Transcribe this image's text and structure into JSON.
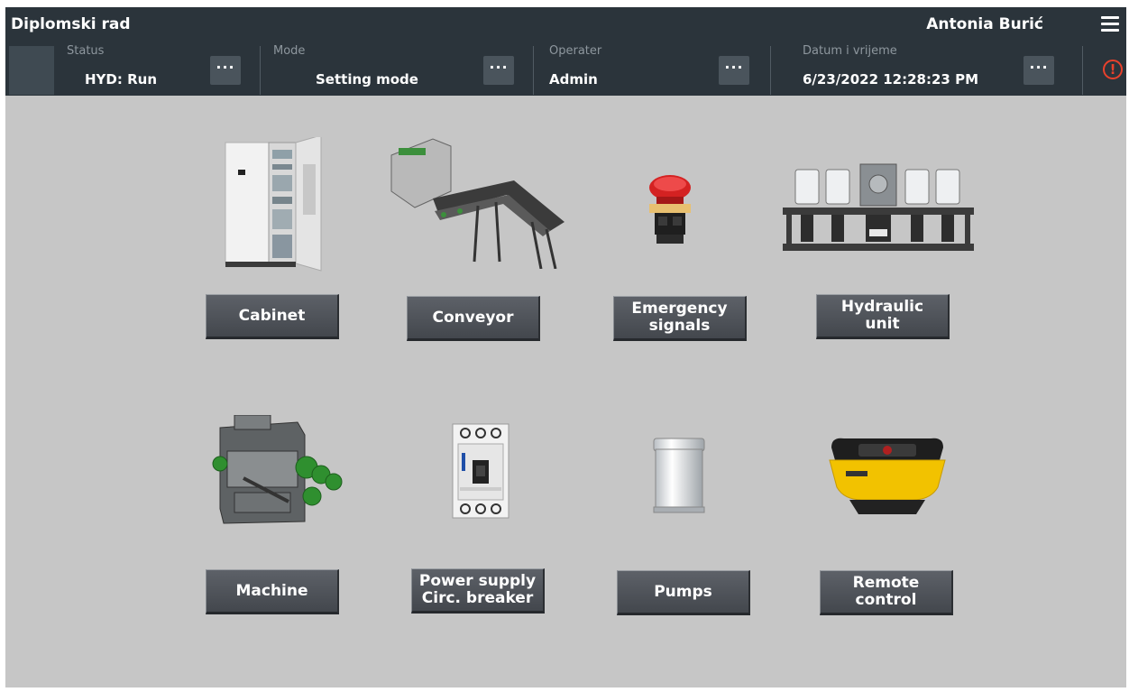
{
  "header": {
    "app_title": "Diplomski rad",
    "user_name": "Antonia Burić"
  },
  "status_bar": {
    "status": {
      "caption": "Status",
      "value": "HYD: Run"
    },
    "mode": {
      "caption": "Mode",
      "value": "Setting mode"
    },
    "operator": {
      "caption": "Operater",
      "value": "Admin"
    },
    "datetime": {
      "caption": "Datum i vrijeme",
      "value": "6/23/2022 12:28:23 PM"
    },
    "more_label": "···",
    "alarm_symbol": "!"
  },
  "buttons": {
    "cabinet": "Cabinet",
    "conveyor": "Conveyor",
    "emergency": "Emergency\nsignals",
    "hydraulic": "Hydraulic\nunit",
    "machine": "Machine",
    "power_supply": "Power supply\nCirc. breaker",
    "pumps": "Pumps",
    "remote": "Remote\ncontrol"
  },
  "icons": {
    "cabinet": "electrical-cabinet-icon",
    "conveyor": "conveyor-icon",
    "emergency": "emergency-stop-button-icon",
    "hydraulic": "hydraulic-unit-icon",
    "machine": "machine-icon",
    "power_supply": "circuit-breaker-icon",
    "pumps": "pump-icon",
    "remote": "remote-control-icon"
  },
  "colors": {
    "header_bg": "#2b343b",
    "content_bg": "#c6c6c6",
    "button_bg": "#4e5258",
    "alarm": "#e8412c",
    "remote_yellow": "#f2c200",
    "estop_red": "#d42222"
  }
}
